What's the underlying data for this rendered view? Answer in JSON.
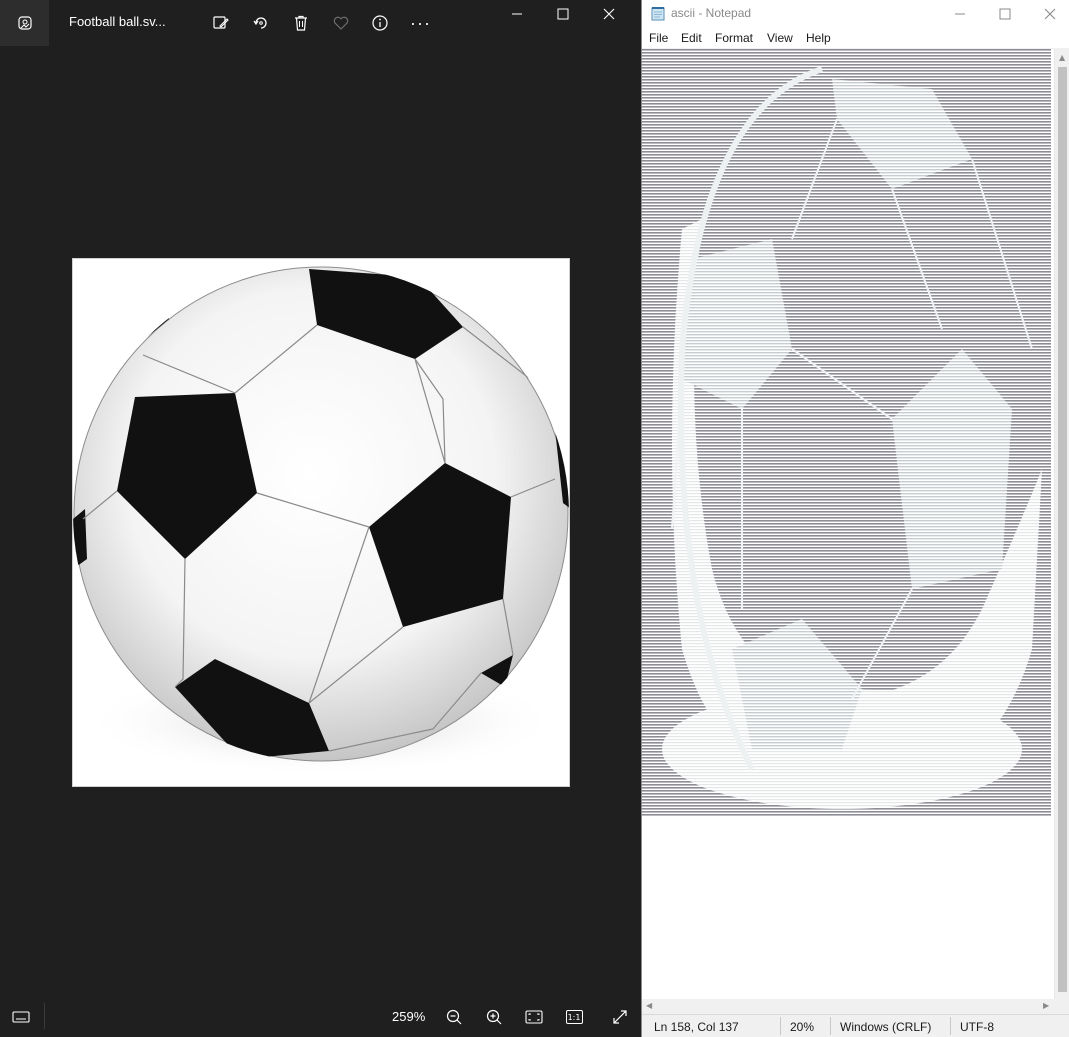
{
  "photos": {
    "title": "Football ball.sv...",
    "icons": {
      "app": "photos-app-icon",
      "edit": "edit-image-icon",
      "rotate": "rotate-icon",
      "delete": "delete-icon",
      "favorite": "heart-icon",
      "info": "info-icon",
      "more": "more-icon",
      "filmstrip": "filmstrip-icon",
      "zoom_out": "zoom-out-icon",
      "zoom_in": "zoom-in-icon",
      "fit": "fit-to-window-icon",
      "actual_size": "actual-size-icon",
      "fullscreen": "fullscreen-icon"
    },
    "more_label": "...",
    "zoom": "259%",
    "actual_size_label": "1:1",
    "background": "#1f1f1f"
  },
  "notepad": {
    "title": "ascii - Notepad",
    "menu": [
      "File",
      "Edit",
      "Format",
      "View",
      "Help"
    ],
    "status": {
      "position": "Ln 158, Col 137",
      "zoom": "20%",
      "line_endings": "Windows (CRLF)",
      "encoding": "UTF-8"
    }
  }
}
